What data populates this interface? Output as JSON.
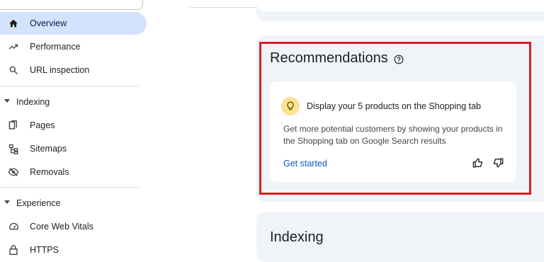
{
  "sidebar": {
    "items": [
      {
        "label": "Overview",
        "icon": "home-icon",
        "active": true
      },
      {
        "label": "Performance",
        "icon": "trending-up-icon",
        "active": false
      },
      {
        "label": "URL inspection",
        "icon": "search-icon",
        "active": false
      }
    ],
    "sections": [
      {
        "label": "Indexing",
        "items": [
          {
            "label": "Pages",
            "icon": "pages-icon"
          },
          {
            "label": "Sitemaps",
            "icon": "sitemap-icon"
          },
          {
            "label": "Removals",
            "icon": "removals-icon"
          }
        ]
      },
      {
        "label": "Experience",
        "items": [
          {
            "label": "Core Web Vitals",
            "icon": "speedometer-icon"
          },
          {
            "label": "HTTPS",
            "icon": "lock-icon"
          }
        ]
      }
    ]
  },
  "main": {
    "recommendations": {
      "title": "Recommendations",
      "card": {
        "title": "Display your 5 products on the Shopping tab",
        "description": "Get more potential customers by showing your products in the Shopping tab on Google Search results",
        "link": "Get started",
        "icon": "lightbulb-icon"
      }
    },
    "indexing": {
      "title": "Indexing"
    }
  },
  "colors": {
    "active_nav_bg": "#d3e3fd",
    "panel_bg": "#f0f4f9",
    "link": "#0b57d0",
    "bulb_bg": "#fde293",
    "highlight_border": "#e01b22"
  }
}
